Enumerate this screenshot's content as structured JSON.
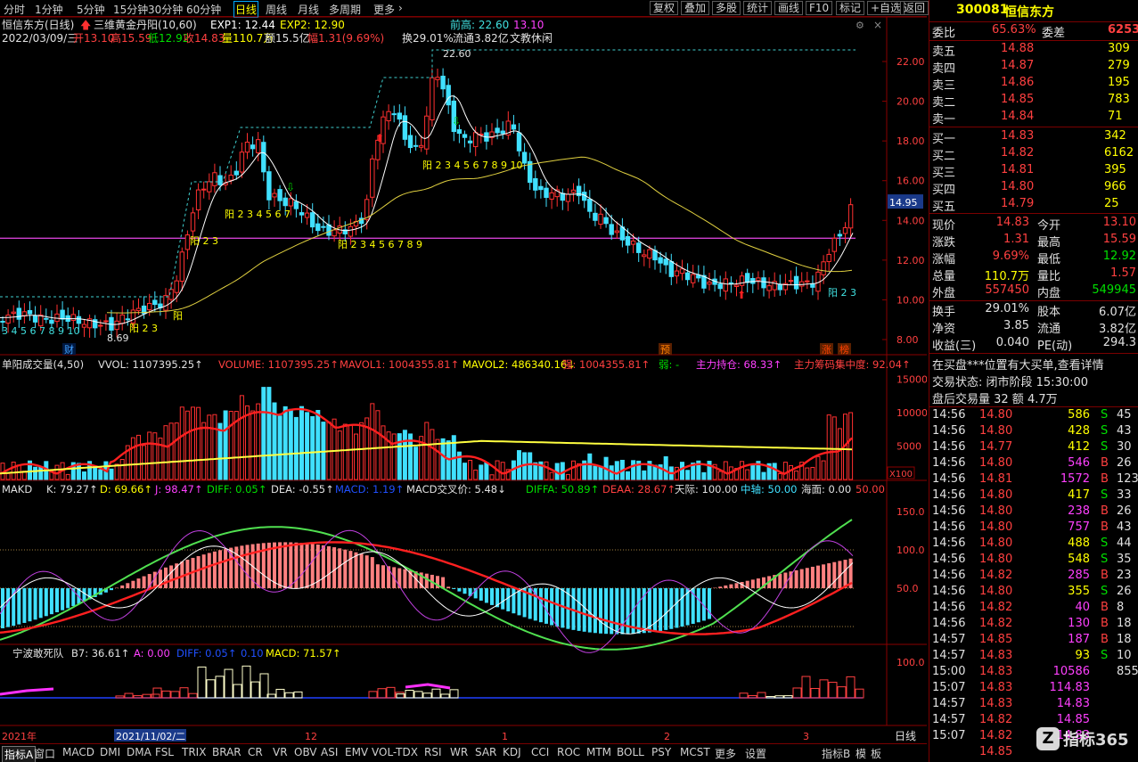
{
  "toolbar": {
    "periods": [
      "分时",
      "1分钟",
      "5分钟",
      "15分钟",
      "30分钟",
      "60分钟",
      "日线",
      "周线",
      "月线",
      "多周期",
      "更多"
    ],
    "active_period": "日线",
    "buttons": [
      "复权",
      "叠加",
      "多股",
      "统计",
      "画线",
      "F10",
      "标记",
      "+自选",
      "返回"
    ]
  },
  "main": {
    "legend": {
      "stock": "恒信东方(日线)",
      "indicator": "三维黄金丹阳(10,60)",
      "exp1": "EXP1: 12.44",
      "exp2": "EXP2: 12.90",
      "prev_high": "前高: 22.60",
      "prev_high2": "13.10"
    },
    "info_line": {
      "date": "2022/03/09/三",
      "open": "开13.10",
      "high": "高15.59",
      "low": "低12.92",
      "close": "收14.83",
      "volume": "量110.7万",
      "amount": "额15.5亿",
      "change": "幅1.31(9.69%)",
      "turnover": "换29.01%",
      "float": "流通3.82亿",
      "note": "文教休闲"
    },
    "price_axis": [
      "22.00",
      "20.00",
      "18.00",
      "16.00",
      "14.00",
      "12.00",
      "10.00",
      "8.00"
    ],
    "price_tag": "14.95",
    "peak_label": "22.60",
    "low_label": "8.69",
    "seq_labels": [
      "3 4 5 6 7 8 9 10",
      "阳 2 3 4 5 6 7",
      "阳 2 3",
      "阳",
      "阳 2 3 4 5 6 7 8 9",
      "阳 2 3 4 5 6 7 8 9 10",
      "阳 2 3",
      "阳 2 3"
    ],
    "markers": [
      "财",
      "预",
      "涨",
      "榜"
    ]
  },
  "volume": {
    "legend": [
      "单阳成交量(4,50)",
      "VVOL: 1107395.25↑",
      "VOLUME: 1107395.25↑",
      "MAVOL1: 1004355.81↑",
      "MAVOL2: 486340.16↓",
      "强: 1004355.81↑",
      "弱: -",
      "主力持仓: 68.33↑",
      "主力筹码集中度: 92.04↑"
    ],
    "axis": [
      "15000",
      "10000",
      "5000"
    ],
    "unit": "X100"
  },
  "makd": {
    "legend": [
      "MAKD",
      "K: 79.27↑",
      "D: 69.66↑",
      "J: 98.47↑",
      "DIFF: 0.05↑",
      "DEA: -0.55↑",
      "MACD: 1.19↑",
      "MACD交叉价: 5.48↓",
      "DIFFA: 50.89↑",
      "DEAA: 28.67↑",
      "天际: 100.00",
      "中轴: 50.00",
      "海面: 0.00",
      "50.00"
    ],
    "axis": [
      "150.0",
      "100.0",
      "50.0"
    ]
  },
  "nb": {
    "legend": [
      "宁波敢死队",
      "B7: 36.61↑",
      "A: 0.00",
      "DIFF: 0.05↑",
      "0.10",
      "MACD: 71.57↑"
    ],
    "axis": [
      "100.0"
    ]
  },
  "time_axis": {
    "labels": [
      "2021年",
      "2021/11/02/二",
      "12",
      "1",
      "2",
      "3"
    ],
    "period": "日线"
  },
  "bottom_tabs": [
    "指标A",
    "窗口",
    "MACD",
    "DMI",
    "DMA",
    "FSL",
    "TRIX",
    "BRAR",
    "CR",
    "VR",
    "OBV",
    "ASI",
    "EMV",
    "VOL-TDX",
    "RSI",
    "WR",
    "SAR",
    "KDJ",
    "CCI",
    "ROC",
    "MTM",
    "BOLL",
    "PSY",
    "MCST",
    "更多",
    "设置",
    "指标B",
    "模",
    "板"
  ],
  "quote": {
    "code": "300081",
    "name": "恒信东方",
    "weibi_label": "委比",
    "weibi": "65.63%",
    "weicha_label": "委差",
    "weicha": "6253",
    "asks": [
      {
        "label": "卖五",
        "price": "14.88",
        "vol": "309"
      },
      {
        "label": "卖四",
        "price": "14.87",
        "vol": "279"
      },
      {
        "label": "卖三",
        "price": "14.86",
        "vol": "195"
      },
      {
        "label": "卖二",
        "price": "14.85",
        "vol": "783"
      },
      {
        "label": "卖一",
        "price": "14.84",
        "vol": "71"
      }
    ],
    "bids": [
      {
        "label": "买一",
        "price": "14.83",
        "vol": "342"
      },
      {
        "label": "买二",
        "price": "14.82",
        "vol": "6162"
      },
      {
        "label": "买三",
        "price": "14.81",
        "vol": "395"
      },
      {
        "label": "买四",
        "price": "14.80",
        "vol": "966"
      },
      {
        "label": "买五",
        "price": "14.79",
        "vol": "25"
      }
    ],
    "stats": [
      [
        "现价",
        "14.83",
        "今开",
        "13.10"
      ],
      [
        "涨跌",
        "1.31",
        "最高",
        "15.59"
      ],
      [
        "涨幅",
        "9.69%",
        "最低",
        "12.92"
      ],
      [
        "总量",
        "110.7万",
        "量比",
        "1.57"
      ],
      [
        "外盘",
        "557450",
        "内盘",
        "549945"
      ]
    ],
    "stats2": [
      [
        "换手",
        "29.01%",
        "股本",
        "6.07亿"
      ],
      [
        "净资",
        "3.85",
        "流通",
        "3.82亿"
      ],
      [
        "收益(三)",
        "0.040",
        "PE(动)",
        "294.3"
      ]
    ],
    "notice": "在买盘***位置有大买单,查看详情",
    "trade_state": "交易状态: 闭市阶段 15:30:00",
    "after_hours": "盘后交易量 32 额 4.7万",
    "ticks": [
      [
        "14:56",
        "14.80",
        "586",
        "S",
        "45"
      ],
      [
        "14:56",
        "14.80",
        "428",
        "S",
        "43"
      ],
      [
        "14:56",
        "14.77",
        "412",
        "S",
        "30"
      ],
      [
        "14:56",
        "14.80",
        "546",
        "B",
        "26"
      ],
      [
        "14:56",
        "14.81",
        "1572",
        "B",
        "123"
      ],
      [
        "14:56",
        "14.80",
        "417",
        "S",
        "33"
      ],
      [
        "14:56",
        "14.80",
        "238",
        "B",
        "26"
      ],
      [
        "14:56",
        "14.80",
        "757",
        "B",
        "43"
      ],
      [
        "14:56",
        "14.80",
        "488",
        "S",
        "44"
      ],
      [
        "14:56",
        "14.80",
        "548",
        "S",
        "35"
      ],
      [
        "14:56",
        "14.82",
        "285",
        "B",
        "23"
      ],
      [
        "14:56",
        "14.80",
        "355",
        "S",
        "26"
      ],
      [
        "14:56",
        "14.82",
        "40",
        "B",
        "8"
      ],
      [
        "14:56",
        "14.82",
        "130",
        "B",
        "18"
      ],
      [
        "14:57",
        "14.85",
        "187",
        "B",
        "18"
      ],
      [
        "14:57",
        "14.83",
        "93",
        "S",
        "10"
      ],
      [
        "15:00",
        "14.83",
        "10586",
        "",
        "855"
      ],
      [
        "15:07",
        "14.83",
        "114.83",
        "",
        ""
      ],
      [
        "14:57",
        "14.83",
        "14.83",
        "",
        ""
      ],
      [
        "14:57",
        "14.82",
        "14.85",
        "",
        ""
      ],
      [
        "15:07",
        "14.82",
        "14.83",
        "",
        ""
      ],
      [
        "",
        "14.85",
        "",
        "",
        ""
      ]
    ],
    "watermark": "指标365"
  }
}
